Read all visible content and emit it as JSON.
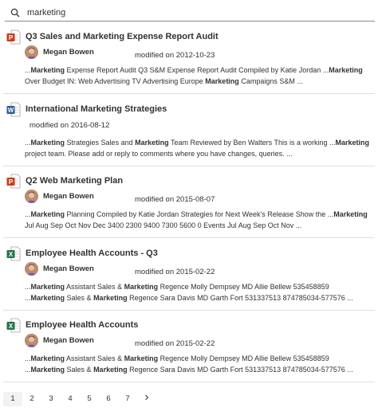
{
  "search": {
    "value": "marketing",
    "icon": "search-icon"
  },
  "results": [
    {
      "type": "powerpoint",
      "title": "Q3 Sales and Marketing Expense Report Audit",
      "author": "Megan Bowen",
      "modified": "modified on 2012-10-23",
      "summary": [
        [
          [
            "...",
            false
          ],
          [
            "Marketing",
            true
          ],
          [
            " Expense Report Audit Q3 S&M Expense Report Audit Compiled by Katie Jordan ...",
            false
          ],
          [
            "Marketing",
            true
          ]
        ],
        [
          [
            " Over Budget IN: Web Advertising TV Advertising Europe ",
            false
          ],
          [
            "Marketing",
            true
          ],
          [
            " Campaigns S&M ...",
            false
          ]
        ]
      ]
    },
    {
      "type": "word",
      "title": "International Marketing Strategies",
      "author": "",
      "modified": "modified on 2016-08-12",
      "summary": [
        [
          [
            "...",
            false
          ],
          [
            "Marketing",
            true
          ],
          [
            " Strategies Sales and ",
            false
          ],
          [
            "Marketing",
            true
          ],
          [
            " Team Reviewed by Ben Walters This is a working ...",
            false
          ],
          [
            "Marketing",
            true
          ]
        ],
        [
          [
            " project team. Please add or reply to comments where you have changes, queries. ...",
            false
          ]
        ]
      ]
    },
    {
      "type": "powerpoint",
      "title": "Q2 Web Marketing Plan",
      "author": "Megan Bowen",
      "modified": "modified on 2015-08-07",
      "summary": [
        [
          [
            "...",
            false
          ],
          [
            "Marketing",
            true
          ],
          [
            " Planning Compiled by Katie Jordan Strategies for Next Week's Release Show the ...",
            false
          ],
          [
            "Marketing",
            true
          ]
        ],
        [
          [
            " Jul Aug Sep Oct Nov Dec 3400 2300 9400 7300 5600 0 Events Jul Aug Sep Oct Nov ...",
            false
          ]
        ]
      ]
    },
    {
      "type": "excel",
      "title": "Employee Health Accounts - Q3",
      "author": "Megan Bowen",
      "modified": "modified on 2015-02-22",
      "summary": [
        [
          [
            "...",
            false
          ],
          [
            "Marketing",
            true
          ],
          [
            " Assistant Sales & ",
            false
          ],
          [
            "Marketing",
            true
          ],
          [
            " Regence Molly Dempsey MD Allie Bellew 535458859",
            false
          ]
        ],
        [
          [
            "...",
            false
          ],
          [
            "Marketing",
            true
          ],
          [
            " Sales & ",
            false
          ],
          [
            "Marketing",
            true
          ],
          [
            " Regence Sara Davis MD Garth Fort 531337513 874785034-577576 ...",
            false
          ]
        ]
      ]
    },
    {
      "type": "excel",
      "title": "Employee Health Accounts",
      "author": "Megan Bowen",
      "modified": "modified on 2015-02-22",
      "summary": [
        [
          [
            "...",
            false
          ],
          [
            "Marketing",
            true
          ],
          [
            " Assistant Sales & ",
            false
          ],
          [
            "Marketing",
            true
          ],
          [
            " Regence Molly Dempsey MD Allie Bellew 535458859",
            false
          ]
        ],
        [
          [
            "...",
            false
          ],
          [
            "Marketing",
            true
          ],
          [
            " Sales & ",
            false
          ],
          [
            "Marketing",
            true
          ],
          [
            " Regence Sara Davis MD Garth Fort 531337513 874785034-577576 ...",
            false
          ]
        ]
      ]
    }
  ],
  "pager": {
    "pages": [
      "1",
      "2",
      "3",
      "4",
      "5",
      "6",
      "7"
    ],
    "active": "1",
    "next_icon": "chevron-right-icon"
  },
  "colors": {
    "powerpoint": "#c43e1c",
    "word": "#2b579a",
    "excel": "#217346",
    "divider": "#e1dfdd"
  }
}
